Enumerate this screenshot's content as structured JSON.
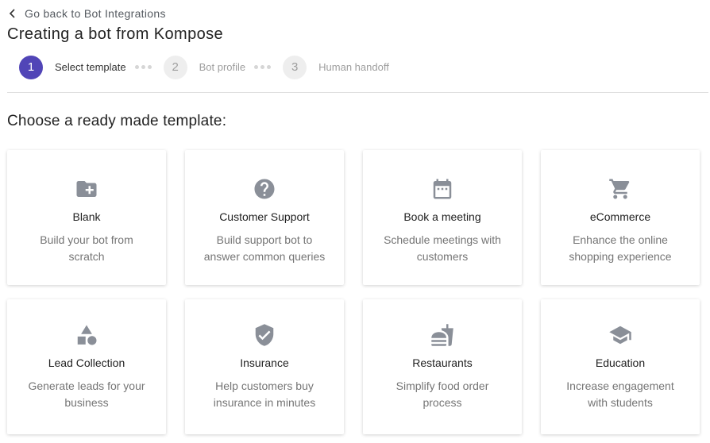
{
  "back": {
    "label": "Go back to Bot Integrations"
  },
  "page_title": "Creating a bot from Kompose",
  "steps": [
    {
      "number": "1",
      "label": "Select template",
      "active": true
    },
    {
      "number": "2",
      "label": "Bot profile",
      "active": false
    },
    {
      "number": "3",
      "label": "Human handoff",
      "active": false
    }
  ],
  "section_title": "Choose a ready made template:",
  "templates": [
    {
      "title": "Blank",
      "desc_line1": "Build your bot from",
      "desc_line2": "scratch",
      "icon": "folder-plus-icon"
    },
    {
      "title": "Customer Support",
      "desc_line1": "Build support bot to",
      "desc_line2": "answer common queries",
      "icon": "help-circle-icon"
    },
    {
      "title": "Book a meeting",
      "desc_line1": "Schedule meetings with",
      "desc_line2": "customers",
      "icon": "calendar-icon"
    },
    {
      "title": "eCommerce",
      "desc_line1": "Enhance the online",
      "desc_line2": "shopping experience",
      "icon": "cart-icon"
    },
    {
      "title": "Lead Collection",
      "desc_line1": "Generate leads for your",
      "desc_line2": "business",
      "icon": "shapes-icon"
    },
    {
      "title": "Insurance",
      "desc_line1": "Help customers buy",
      "desc_line2": "insurance in minutes",
      "icon": "shield-check-icon"
    },
    {
      "title": "Restaurants",
      "desc_line1": "Simplify food order",
      "desc_line2": "process",
      "icon": "fastfood-icon"
    },
    {
      "title": "Education",
      "desc_line1": "Increase engagement",
      "desc_line2": "with students",
      "icon": "graduation-cap-icon"
    }
  ],
  "colors": {
    "accent": "#5145b7",
    "icon_gray": "#8a8f98",
    "muted_text": "#757575"
  }
}
